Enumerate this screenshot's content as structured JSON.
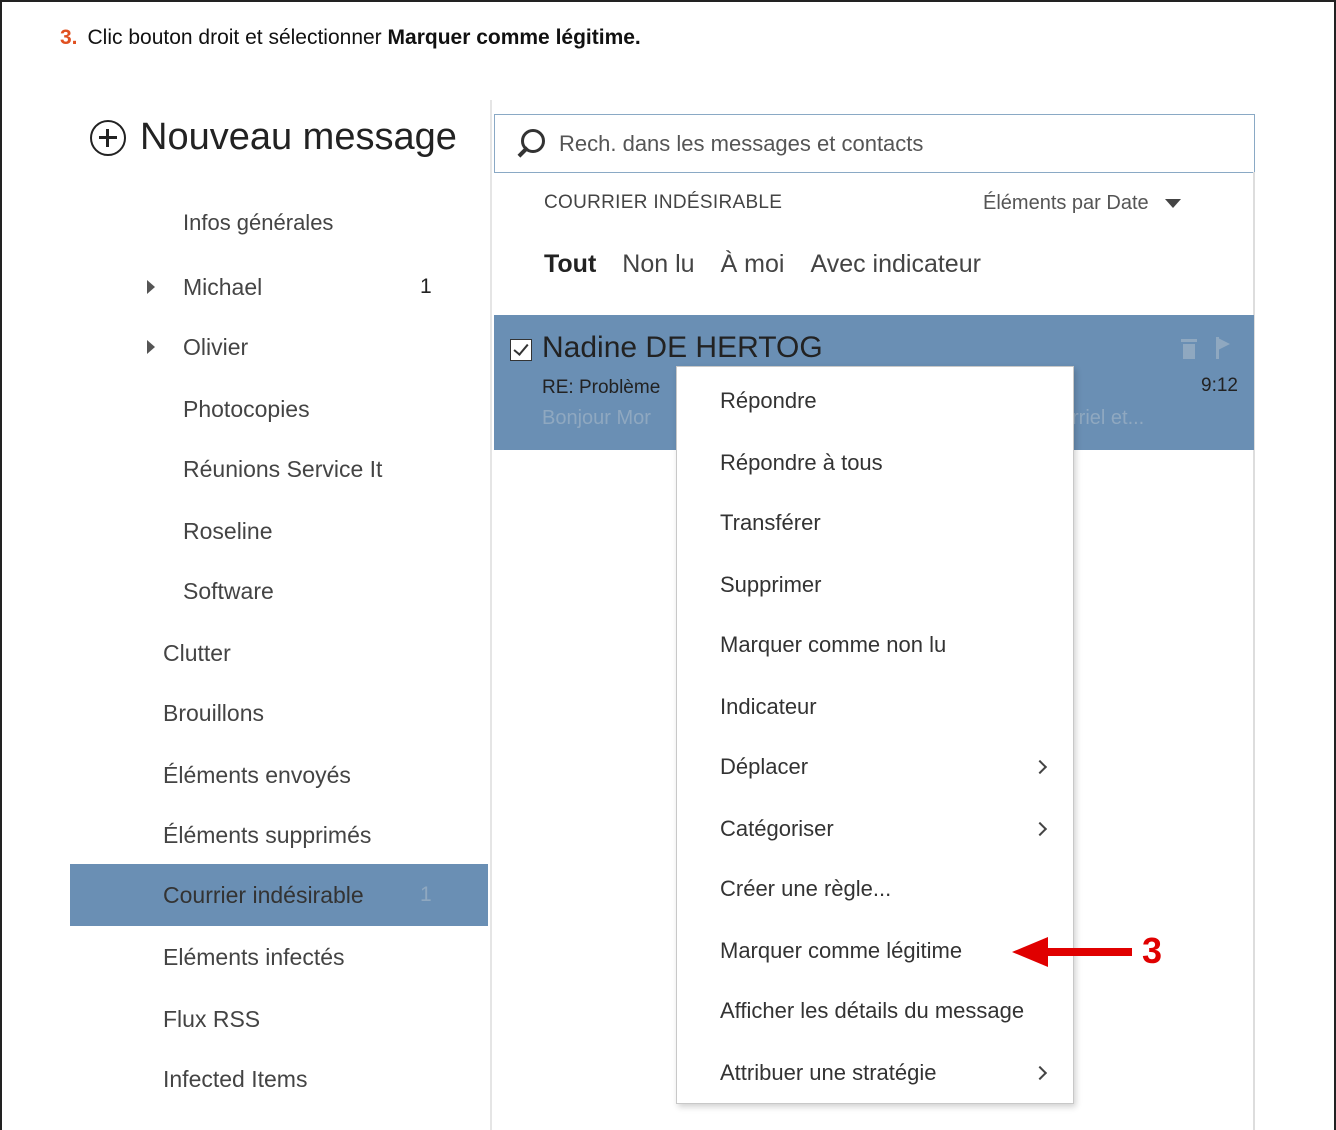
{
  "instruction": {
    "number": "3.",
    "text": "Clic bouton droit et sélectionner ",
    "bold": "Marquer comme légitime."
  },
  "sidebar": {
    "new_message": "Nouveau message",
    "clipped_folder": "Infos générales",
    "folders": [
      {
        "label": "Michael",
        "count": "1",
        "expandable": true
      },
      {
        "label": "Olivier",
        "count": "",
        "expandable": true
      },
      {
        "label": "Photocopies",
        "count": ""
      },
      {
        "label": "Réunions Service It",
        "count": ""
      },
      {
        "label": "Roseline",
        "count": ""
      },
      {
        "label": "Software",
        "count": ""
      },
      {
        "label": "Clutter",
        "count": ""
      },
      {
        "label": "Brouillons",
        "count": ""
      },
      {
        "label": "Éléments envoyés",
        "count": ""
      },
      {
        "label": "Éléments supprimés",
        "count": ""
      },
      {
        "label": "Courrier indésirable",
        "count": "1",
        "selected": true
      },
      {
        "label": "Eléments infectés",
        "count": ""
      },
      {
        "label": "Flux RSS",
        "count": ""
      },
      {
        "label": "Infected Items",
        "count": ""
      }
    ]
  },
  "search": {
    "placeholder": "Rech. dans les messages et contacts"
  },
  "list": {
    "folder_title": "COURRIER INDÉSIRABLE",
    "sort_label": "Éléments par Date",
    "filters": [
      "Tout",
      "Non lu",
      "À moi",
      "Avec indicateur"
    ],
    "active_filter": "Tout",
    "message": {
      "sender": "Nadine DE HERTOG",
      "subject": "RE: Problème",
      "preview": "Bonjour Mor",
      "preview_end": "rriel et...",
      "time": "9:12"
    }
  },
  "context_menu": {
    "items": [
      {
        "label": "Répondre",
        "submenu": false
      },
      {
        "label": "Répondre à tous",
        "submenu": false
      },
      {
        "label": "Transférer",
        "submenu": false
      },
      {
        "label": "Supprimer",
        "submenu": false
      },
      {
        "label": "Marquer comme non lu",
        "submenu": false
      },
      {
        "label": "Indicateur",
        "submenu": false
      },
      {
        "label": "Déplacer",
        "submenu": true
      },
      {
        "label": "Catégoriser",
        "submenu": true
      },
      {
        "label": "Créer une règle...",
        "submenu": false
      },
      {
        "label": "Marquer comme légitime",
        "submenu": false
      },
      {
        "label": "Afficher les détails du message",
        "submenu": false
      },
      {
        "label": "Attribuer une stratégie",
        "submenu": true
      }
    ]
  },
  "annotation": {
    "step": "3",
    "color": "#e00000"
  },
  "colors": {
    "selection": "#6a8fb4",
    "search_border": "#8aa9c5",
    "step_number": "#e05020"
  }
}
